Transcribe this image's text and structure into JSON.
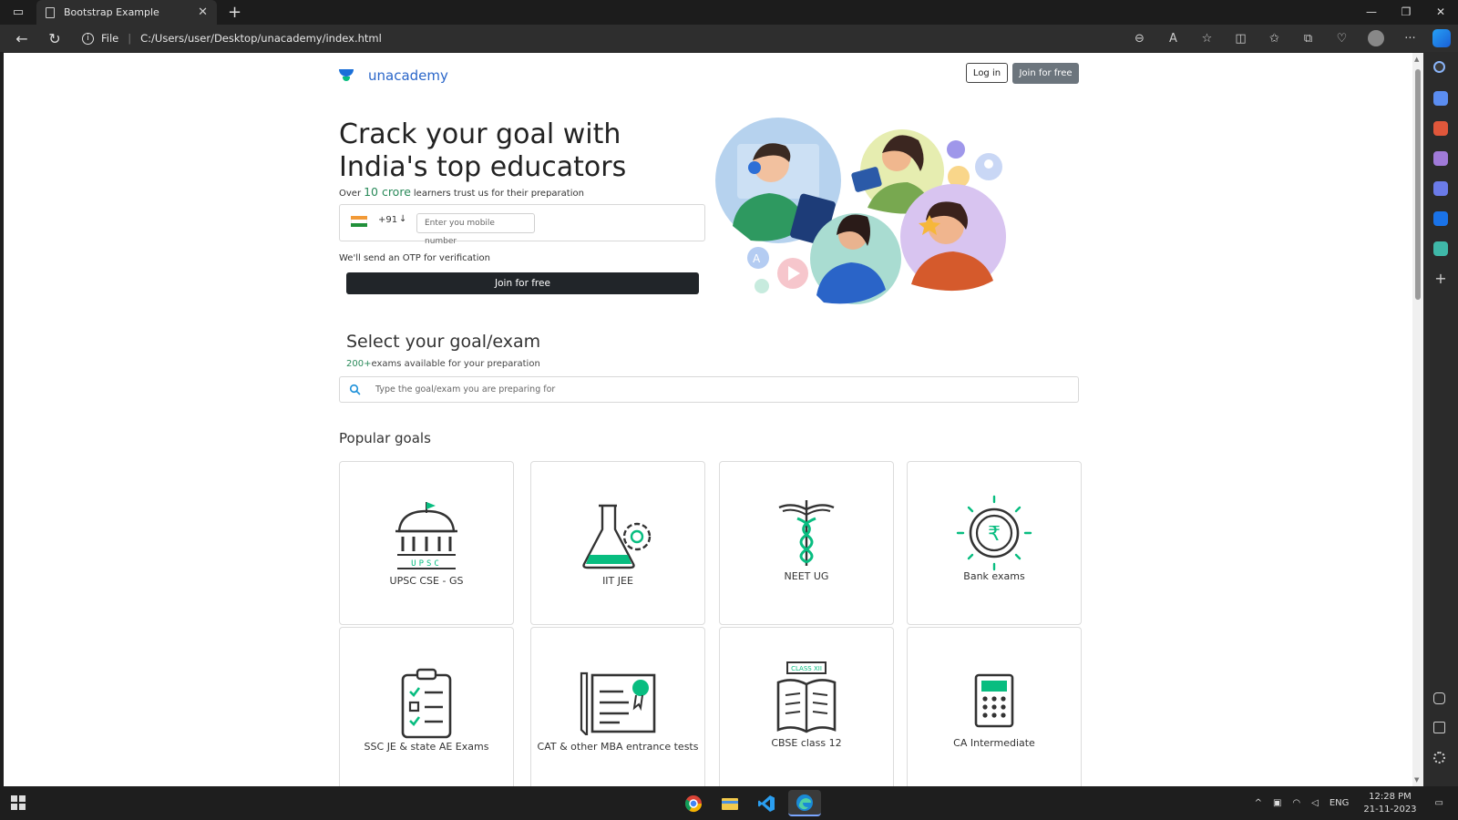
{
  "browser": {
    "tab_title": "Bootstrap Example",
    "url_scheme": "File",
    "url": "C:/Users/user/Desktop/unacademy/index.html"
  },
  "site": {
    "brand": "unacademy",
    "login_label": "Log in",
    "join_top_label": "Join for free"
  },
  "hero": {
    "title": "Crack your goal with India's top educators",
    "sub_before": "Over",
    "sub_highlight": "10 crore",
    "sub_after": "learners trust us for their preparation",
    "country_code": "+91",
    "caret": "↓",
    "mobile_placeholder": "Enter you mobile number",
    "otp_note": "We'll send an OTP for verification",
    "join_label": "Join for free"
  },
  "goal": {
    "title": "Select your goal/exam",
    "sub_highlight": "200+",
    "sub_rest": "exams available for your preparation",
    "search_placeholder": "Type the goal/exam you are preparing for"
  },
  "popular": {
    "title": "Popular goals",
    "cards": [
      {
        "label": "UPSC CSE - GS",
        "icon": "upsc-dome-icon"
      },
      {
        "label": "IIT JEE",
        "icon": "flask-gear-icon"
      },
      {
        "label": "NEET UG",
        "icon": "caduceus-icon"
      },
      {
        "label": "Bank exams",
        "icon": "rupee-coin-icon"
      },
      {
        "label": "SSC JE & state AE Exams",
        "icon": "clipboard-checklist-icon"
      },
      {
        "label": "CAT & other MBA entrance tests",
        "icon": "certificate-icon"
      },
      {
        "label": "CBSE class 12",
        "icon": "open-book-icon",
        "badge": "CLASS XII"
      },
      {
        "label": "CA Intermediate",
        "icon": "calculator-icon"
      }
    ]
  },
  "taskbar": {
    "lang": "ENG",
    "time": "12:28 PM",
    "date": "21-11-2023"
  },
  "colors": {
    "brand_blue": "#2a66c9",
    "accent_green": "#08bd80",
    "dark_button": "#212529",
    "grey_button": "#6c757d"
  }
}
